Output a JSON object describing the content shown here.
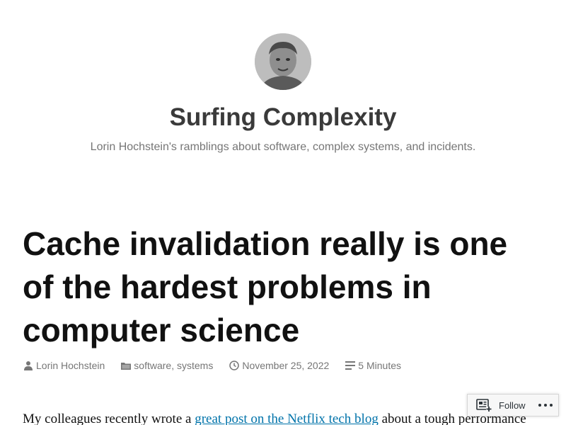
{
  "site": {
    "title": "Surfing Complexity",
    "tagline": "Lorin Hochstein's ramblings about software, complex systems, and incidents."
  },
  "post": {
    "title": "Cache invalidation really is one of the hardest problems in computer science",
    "author": "Lorin Hochstein",
    "category_1": "software",
    "category_separator": ", ",
    "category_2": "systems",
    "date": "November 25, 2022",
    "read_time": "5 Minutes",
    "body_prefix": "My colleagues recently wrote a ",
    "body_link": "great post on the Netflix tech blog",
    "body_suffix": " about a tough performance"
  },
  "follow_bar": {
    "follow_label": "Follow"
  },
  "icons": {
    "author": "person-icon",
    "category": "folder-icon",
    "date": "clock-icon",
    "read_time": "reading-time-icon",
    "follow": "reader-follow-icon",
    "more": "more-dots-icon"
  },
  "colors": {
    "link": "#0073aa",
    "meta": "#767676",
    "title": "#111111"
  }
}
